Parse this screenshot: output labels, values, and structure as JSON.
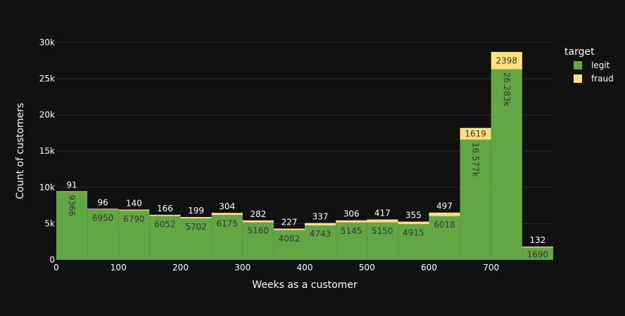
{
  "chart_data": {
    "type": "bar",
    "barmode": "stack",
    "xlabel": "Weeks as a customer",
    "ylabel": "Count of customers",
    "legend_title": "target",
    "legend_position": "top-right",
    "bin_starts": [
      0,
      50,
      100,
      150,
      200,
      250,
      300,
      350,
      400,
      450,
      500,
      550,
      600,
      650,
      700,
      750
    ],
    "bin_width": 50,
    "x_ticks": [
      0,
      100,
      200,
      300,
      400,
      500,
      600,
      700
    ],
    "x_tick_labels": [
      "0",
      "100",
      "200",
      "300",
      "400",
      "500",
      "600",
      "700"
    ],
    "xlim": [
      0,
      800
    ],
    "y_ticks": [
      0,
      5000,
      10000,
      15000,
      20000,
      25000,
      30000
    ],
    "y_tick_labels": [
      "0",
      "5k",
      "10k",
      "15k",
      "20k",
      "25k",
      "30k"
    ],
    "ylim": [
      0,
      31000
    ],
    "grid": true,
    "series": [
      {
        "name": "legit",
        "color": "#62a744",
        "values": [
          9366,
          6950,
          6790,
          6052,
          5702,
          6175,
          5160,
          4082,
          4743,
          5145,
          5150,
          4915,
          6018,
          16577,
          26283,
          1690
        ],
        "labels": [
          "9366",
          "6950",
          "6790",
          "6052",
          "5702",
          "6175",
          "5160",
          "4082",
          "4743",
          "5145",
          "5150",
          "4915",
          "6018",
          "16.577k",
          "26.283k",
          "1690"
        ]
      },
      {
        "name": "fraud",
        "color": "#fbe17d",
        "values": [
          91,
          96,
          140,
          166,
          199,
          304,
          282,
          227,
          337,
          306,
          417,
          355,
          497,
          1619,
          2398,
          132
        ],
        "labels": [
          "91",
          "96",
          "140",
          "166",
          "199",
          "304",
          "282",
          "227",
          "337",
          "306",
          "417",
          "355",
          "497",
          "1619",
          "2398",
          "132"
        ]
      }
    ]
  }
}
